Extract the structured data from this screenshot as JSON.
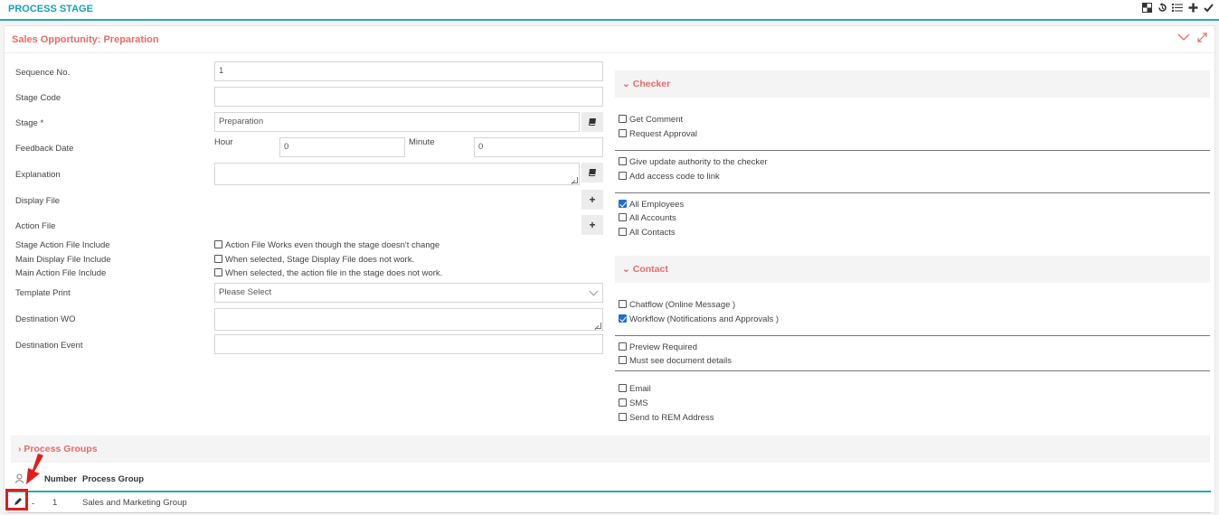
{
  "app_title": "PROCESS STAGE",
  "toolbar_icons": [
    "layout-icon",
    "history-icon",
    "list-icon",
    "plus-icon",
    "check-icon"
  ],
  "panel": {
    "title": "Sales Opportunity: Preparation"
  },
  "form": {
    "sequence_label": "Sequence No.",
    "sequence_value": "1",
    "stage_code_label": "Stage Code",
    "stage_code_value": "",
    "stage_label": "Stage *",
    "stage_value": "Preparation",
    "feedback_label": "Feedback Date",
    "hour_label": "Hour",
    "hour_value": "0",
    "minute_label": "Minute",
    "minute_value": "0",
    "explanation_label": "Explanation",
    "display_file_label": "Display File",
    "action_file_label": "Action File",
    "stage_action_include_label": "Stage Action File Include",
    "stage_action_include_text": "Action File Works even though the stage doesn't change",
    "main_display_include_label": "Main Display File Include",
    "main_display_include_text": "When selected, Stage Display File does not work.",
    "main_action_include_label": "Main Action File Include",
    "main_action_include_text": "When selected, the action file in the stage does not work.",
    "template_print_label": "Template Print",
    "template_print_value": "Please Select",
    "destination_wo_label": "Destination WO",
    "destination_event_label": "Destination Event"
  },
  "checker": {
    "title": "Checker",
    "get_comment": "Get Comment",
    "request_approval": "Request Approval",
    "give_update": "Give update authority to the checker",
    "add_access": "Add access code to link",
    "all_employees": "All Employees",
    "all_accounts": "All Accounts",
    "all_contacts": "All Contacts"
  },
  "contact": {
    "title": "Contact",
    "chatflow": "Chatflow (Online Message )",
    "workflow": "Workflow (Notifications and Approvals )",
    "preview_required": "Preview Required",
    "must_see": "Must see document details",
    "email": "Email",
    "sms": "SMS",
    "send_rem": "Send to REM Address"
  },
  "process_groups": {
    "title": "Process Groups",
    "col_number": "Number",
    "col_group": "Process Group",
    "rows": [
      {
        "number": "1",
        "group": "Sales and Marketing Group"
      }
    ]
  },
  "colors": {
    "accent": "#2aa7b5",
    "title_red": "#e86b6b",
    "highlight": "#e21b1b"
  }
}
